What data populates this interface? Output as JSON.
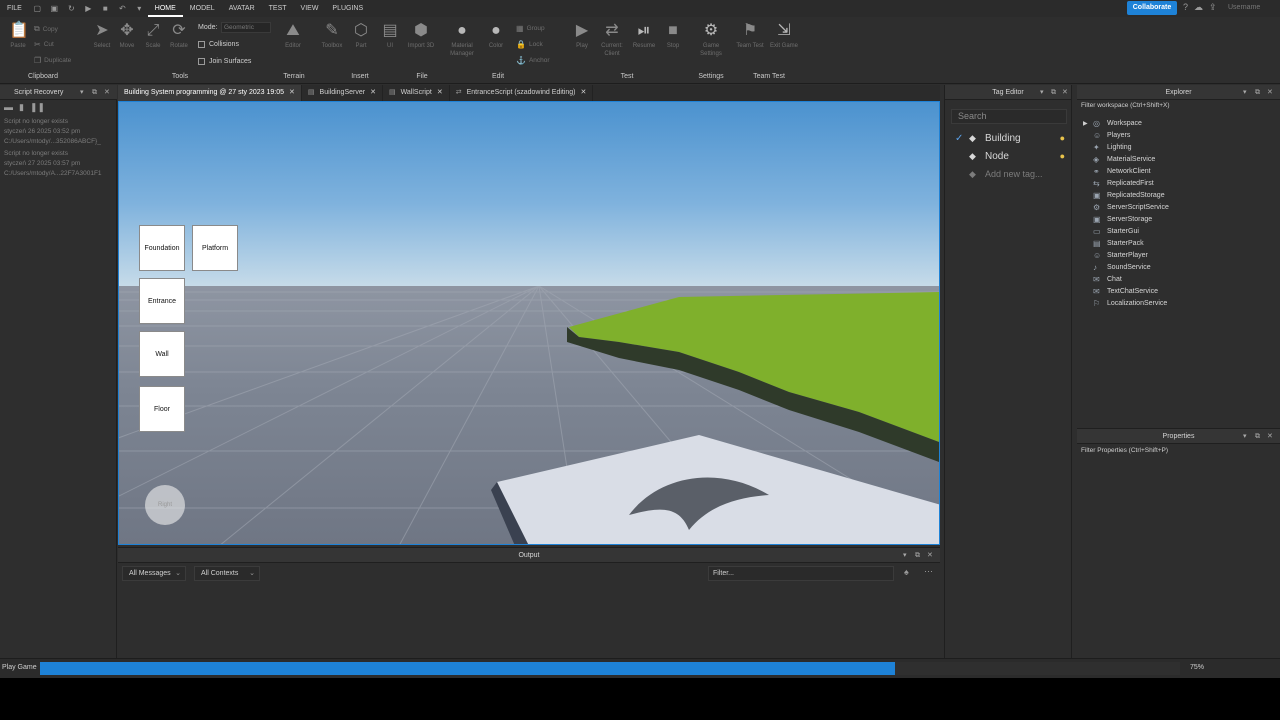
{
  "menubar": {
    "items": [
      "FILE",
      "HOME",
      "MODEL",
      "AVATAR",
      "TEST",
      "VIEW",
      "PLUGINS"
    ],
    "active": "HOME",
    "collaborate_label": "Collaborate",
    "username": "Username"
  },
  "ribbon": {
    "clipboard": {
      "paste": "Paste",
      "copy": "Copy",
      "cut": "Cut",
      "duplicate": "Duplicate",
      "group_label": "Clipboard"
    },
    "tools": {
      "select": "Select",
      "move": "Move",
      "scale": "Scale",
      "rotate": "Rotate",
      "group_label": "Tools"
    },
    "mode": {
      "label": "Mode:",
      "value": "Geometric",
      "collisions": "Collisions",
      "join_surfaces": "Join Surfaces"
    },
    "terrain": {
      "editor": "Editor",
      "group_label": "Terrain"
    },
    "insert": {
      "toolbox": "Toolbox",
      "part": "Part",
      "ui": "UI",
      "group_label": "Insert"
    },
    "file": {
      "import3d": "Import 3D",
      "group_label": "File"
    },
    "edit": {
      "material_manager": "Material Manager",
      "color": "Color",
      "group": "Group",
      "lock": "Lock",
      "anchor": "Anchor",
      "group_label": "Edit"
    },
    "test": {
      "play": "Play",
      "current_client": "Current: Client",
      "resume": "Resume",
      "stop": "Stop",
      "group_label": "Test"
    },
    "settings": {
      "game_settings": "Game Settings",
      "group_label": "Settings"
    },
    "team_test": {
      "team_test": "Team Test",
      "exit_game": "Exit Game",
      "group_label": "Team Test"
    }
  },
  "script_recovery": {
    "title": "Script Recovery",
    "lines": [
      "Script no longer exists",
      "styczeń 26 2025 03:52 pm",
      "C:/Users/mtody/...352086ABCF}_",
      "Script no longer exists",
      "styczeń 27 2025 03:57 pm",
      "C:/Users/mtody/A...22F7A3001F1"
    ]
  },
  "tabs": [
    {
      "label": "Building System programming @ 27 sty 2023 19:05",
      "active": true
    },
    {
      "label": "BuildingServer",
      "active": false
    },
    {
      "label": "WallScript",
      "active": false
    },
    {
      "label": "EntranceScript (szadowind Editing)",
      "active": false
    }
  ],
  "viewport": {
    "build_buttons": [
      "Foundation",
      "Platform",
      "Entrance",
      "Wall",
      "Floor"
    ],
    "touch_button": "Right"
  },
  "output": {
    "title": "Output",
    "messages_filter": "All Messages",
    "contexts_filter": "All Contexts",
    "filter_placeholder": "Filter..."
  },
  "tag_editor": {
    "title": "Tag Editor",
    "search_placeholder": "Search",
    "tags": [
      {
        "name": "Building",
        "checked": true
      },
      {
        "name": "Node",
        "checked": false
      }
    ],
    "add_new": "Add new tag..."
  },
  "explorer": {
    "title": "Explorer",
    "filter_placeholder": "Filter workspace (Ctrl+Shift+X)",
    "items": [
      {
        "label": "Workspace",
        "icon": "workspace-icon",
        "expandable": true
      },
      {
        "label": "Players",
        "icon": "players-icon",
        "expandable": false
      },
      {
        "label": "Lighting",
        "icon": "lighting-icon",
        "expandable": false
      },
      {
        "label": "MaterialService",
        "icon": "material-icon",
        "expandable": false
      },
      {
        "label": "NetworkClient",
        "icon": "network-icon",
        "expandable": false
      },
      {
        "label": "ReplicatedFirst",
        "icon": "replicated-icon",
        "expandable": false
      },
      {
        "label": "ReplicatedStorage",
        "icon": "storage-icon",
        "expandable": false
      },
      {
        "label": "ServerScriptService",
        "icon": "script-service-icon",
        "expandable": false
      },
      {
        "label": "ServerStorage",
        "icon": "storage-icon",
        "expandable": false
      },
      {
        "label": "StarterGui",
        "icon": "gui-icon",
        "expandable": false
      },
      {
        "label": "StarterPack",
        "icon": "pack-icon",
        "expandable": false
      },
      {
        "label": "StarterPlayer",
        "icon": "player-icon",
        "expandable": false
      },
      {
        "label": "SoundService",
        "icon": "sound-icon",
        "expandable": false
      },
      {
        "label": "Chat",
        "icon": "chat-icon",
        "expandable": false
      },
      {
        "label": "TextChatService",
        "icon": "textchat-icon",
        "expandable": false
      },
      {
        "label": "LocalizationService",
        "icon": "localization-icon",
        "expandable": false
      }
    ]
  },
  "properties": {
    "title": "Properties",
    "filter_placeholder": "Filter Properties (Ctrl+Shift+P)"
  },
  "statusbar": {
    "text": "Play Game",
    "progress_percent": 75,
    "progress_label": "75%"
  },
  "colors": {
    "accent": "#1e82d7",
    "check": "#5aa0e8",
    "bulb": "#e9c34b"
  }
}
